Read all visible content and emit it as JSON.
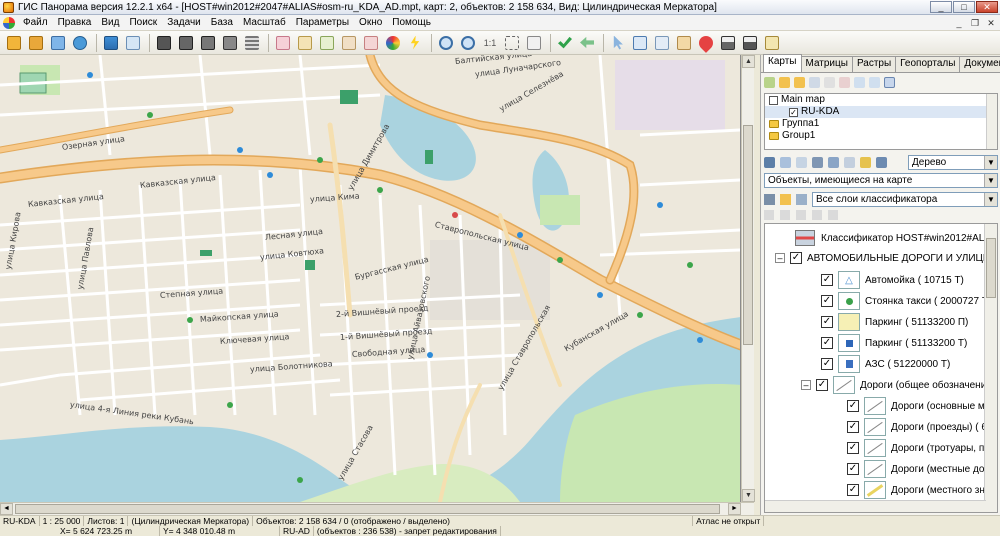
{
  "window": {
    "title": "ГИС Панорама версия 12.2.1 x64 - [HOST#win2012#2047#ALIAS#osm-ru_KDA_AD.mpt, карт: 2, объектов: 2 158 634, Вид: Цилиндрическая Меркатора]",
    "minimize": "_",
    "maximize": "□",
    "close": "✕"
  },
  "menu": [
    "Файл",
    "Правка",
    "Вид",
    "Поиск",
    "Задачи",
    "База",
    "Масштаб",
    "Параметры",
    "Окно",
    "Помощь"
  ],
  "map": {
    "streets": [
      "Озерная улица",
      "Кавказская улица",
      "Кавказская улица",
      "улица Кирова",
      "улица Калинина",
      "улица Павлова",
      "Ставропольская улица",
      "улица Кима",
      "улица Ким",
      "Лесная улица",
      "улица Ковтюха",
      "улица Стасова",
      "улица Болотникова",
      "Ключевая улица",
      "Майкопская улица",
      "Степная улица",
      "Бургасская улица",
      "1-й Вишнёвый проезд",
      "2-й Вишнёвый проезд",
      "Свободная улица",
      "Кубанская улица",
      "улица Луначарского",
      "улица Селезнёва",
      "Балтийская улица",
      "улица Димитрова",
      "улица Стасова",
      "улица 4-я Линия реки Кубань",
      "Ставропольская улица",
      "улица Айвазовского",
      "улица Ставропольская"
    ]
  },
  "panel": {
    "tabs": [
      "Карты",
      "Матрицы",
      "Растры",
      "Геопорталы",
      "Докумен"
    ],
    "active_tab": "Карты",
    "tree": [
      {
        "label": "Main map",
        "type": "checkbox",
        "checked": false
      },
      {
        "label": "RU-KDA",
        "type": "checkbox",
        "checked": true
      },
      {
        "label": "Группа1",
        "type": "folder"
      },
      {
        "label": "Group1",
        "type": "folder"
      }
    ],
    "view_mode": "Дерево",
    "objects_filter": "Объекты, имеющиеся на карте",
    "layer_filter": "Все слои классификатора",
    "legend": {
      "classifier": "Классификатор HOST#win2012#ALIAS#OS",
      "group": "АВТОМОБИЛЬНЫЕ ДОРОГИ И УЛИЦЫ",
      "items": [
        {
          "label": "Автомойка ( 10715 Т)",
          "checked": true
        },
        {
          "label": "Стоянка такси ( 2000727 Т)",
          "checked": true
        },
        {
          "label": "Паркинг ( 51133200 П)",
          "checked": true
        },
        {
          "label": "Паркинг ( 51133200 Т)",
          "checked": true
        },
        {
          "label": "АЗС ( 51220000 Т)",
          "checked": true
        },
        {
          "label": "Дороги (общее обозначение) ( 6",
          "checked": true,
          "expandable": true
        },
        {
          "label": "Дороги (основные местны",
          "checked": true
        },
        {
          "label": "Дороги (проезды) ( 61230",
          "checked": true
        },
        {
          "label": "Дороги (тротуары, пешех",
          "checked": true
        },
        {
          "label": "Дороги (местные дороги)",
          "checked": true
        },
        {
          "label": "Дороги (местного значен",
          "checked": true
        }
      ]
    }
  },
  "status": {
    "map_name": "RU-KDA",
    "scale": "1 : 25 000",
    "sheets": "Листов: 1",
    "projection": "(Цилиндрическая Меркатора)",
    "objects": "Объектов: 2 158 634 / 0 (отображено / выделено)",
    "atlas": "Атлас не открыт",
    "x": "X= 5 624 723.25 m",
    "y": "Y= 4 348 010.48 m",
    "layer": "RU-AD",
    "layer_objects": "(объектов : 236 538) - запрет редактирования"
  },
  "colors": {
    "main_road": "#f7c98a",
    "road_casing": "#e2a85a",
    "water": "#aad3df",
    "park": "#c8e7b2",
    "land": "#ede8dc"
  }
}
